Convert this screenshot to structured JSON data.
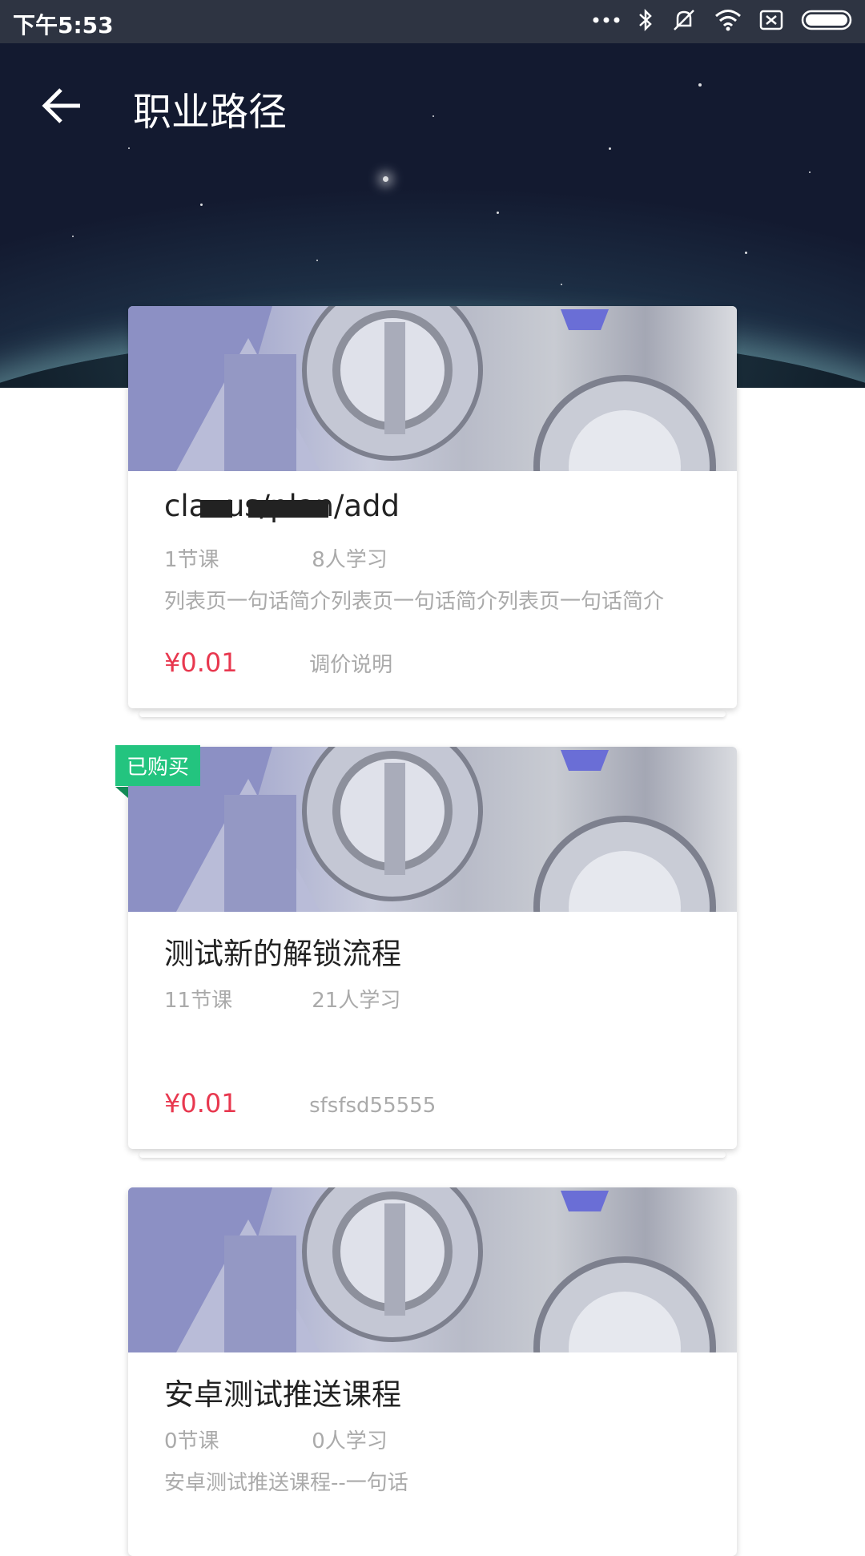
{
  "status_bar": {
    "time": "下午5:53",
    "icons": [
      "more-dots-icon",
      "bluetooth-icon",
      "mute-icon",
      "wifi-icon",
      "sim-icon",
      "battery-icon"
    ]
  },
  "header": {
    "title": "职业路径",
    "back_icon": "arrow-left-icon"
  },
  "courses": [
    {
      "title": "cla                  .us/plan/add",
      "lessons": "1节课",
      "learners": "8人学习",
      "description": "列表页一句话简介列表页一句话简介列表页一句话简介",
      "price": "¥0.01",
      "price_note": "调价说明",
      "badge": ""
    },
    {
      "title": "测试新的解锁流程",
      "lessons": "11节课",
      "learners": "21人学习",
      "description": "",
      "price": "¥0.01",
      "price_note": "sfsfsd55555",
      "badge": "已购买"
    },
    {
      "title": "安卓测试推送课程",
      "lessons": "0节课",
      "learners": "0人学习",
      "description": "安卓测试推送课程--一句话",
      "price": "",
      "price_note": "",
      "badge": ""
    }
  ],
  "colors": {
    "price": "#e8384f",
    "badge": "#23c47f",
    "status_bar": "#2e3442",
    "muted_text": "#aaaaaa"
  }
}
